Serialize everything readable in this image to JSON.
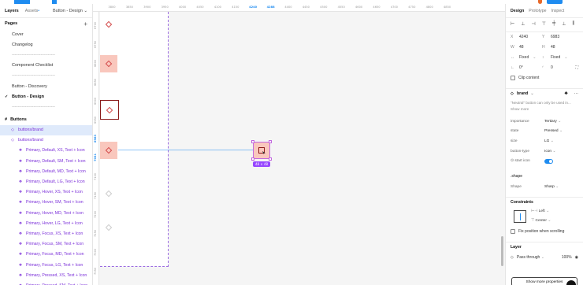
{
  "left": {
    "tabs": [
      "Layers",
      "Assets"
    ],
    "page_selector": "Button - Design",
    "pages_title": "Pages",
    "pages": [
      {
        "label": "Cover",
        "current": false
      },
      {
        "label": "Changelog",
        "current": false
      },
      {
        "label": "------------------------------",
        "current": false
      },
      {
        "label": "Component Checklist",
        "current": false
      },
      {
        "label": "------------------------------",
        "current": false
      },
      {
        "label": "Button - Discovery",
        "current": false
      },
      {
        "label": "Button - Design",
        "current": true
      },
      {
        "label": "------------------------------",
        "current": false
      }
    ],
    "layers_section": "Buttons",
    "selected_layer": "buttons/brand",
    "layer_parent": "buttons/brand",
    "layers": [
      "Primary, Default, XS, Text + Icon",
      "Primary, Default, SM, Text + Icon",
      "Primary, Default, MD, Text + Icon",
      "Primary, Default, LG, Text + Icon",
      "Primary, Hover, XS, Text + Icon",
      "Primary, Hover, SM, Text + Icon",
      "Primary, Hover, MD, Text + Icon",
      "Primary, Hover, LG, Text + Icon",
      "Primary, Focus, XS, Text + Icon",
      "Primary, Focus, SM, Text + Icon",
      "Primary, Focus, MD, Text + Icon",
      "Primary, Focus, LG, Text + Icon",
      "Primary, Pressed, XS, Text + Icon",
      "Primary, Pressed, SM, Text + Icon"
    ]
  },
  "canvas": {
    "hruler": [
      "3800",
      "3850",
      "3900",
      "3950",
      "4000",
      "4050",
      "4100",
      "4150",
      "4240",
      "4288",
      "4400",
      "4450",
      "4500",
      "4550",
      "4600",
      "4650",
      "4700",
      "4750",
      "4800",
      "4850"
    ],
    "hruler_highlight": [
      "4240",
      "4288"
    ],
    "vruler": [
      "6700",
      "6750",
      "6800",
      "6850",
      "6900",
      "6950",
      "6983",
      "7031",
      "7100",
      "7150",
      "7200",
      "7250",
      "7300",
      "7350"
    ],
    "vruler_highlight": [
      "6983",
      "7031"
    ],
    "size_badge": "48 × 48"
  },
  "right": {
    "tabs": [
      "Design",
      "Prototype",
      "Inspect"
    ],
    "x_label": "X",
    "x": "4240",
    "y_label": "Y",
    "y": "6983",
    "w_label": "W",
    "w": "48",
    "h_label": "H",
    "h": "48",
    "w_mode": "Fixed",
    "h_mode": "Fixed",
    "rotation": "0°",
    "radius": "0",
    "clip_content": "Clip content",
    "instance_name": "brand",
    "instance_note": "\"Neutral\" button can only be used in...",
    "show_more": "Show more",
    "props": [
      {
        "k": "importance",
        "v": "Tertiary"
      },
      {
        "k": "state",
        "v": "Pressed"
      },
      {
        "k": "size",
        "v": "LG"
      },
      {
        "k": "button-type",
        "v": "Icon"
      }
    ],
    "start_icon_label": "start icon",
    "shape_section": ".shape",
    "shape_label": "Shape",
    "shape_value": "Sharp",
    "constraints_title": "Constraints",
    "constraint_h": "Left",
    "constraint_v": "Center",
    "fix_position": "Fix position when scrolling",
    "layer_title": "Layer",
    "blend": "Pass through",
    "opacity": "100%",
    "show_more_props": "Show more properties"
  },
  "colors": {
    "accent": "#1f8cf0",
    "component": "#7b2fd9",
    "swatch": "#f9c7bd",
    "outline": "#8b1a1a"
  }
}
